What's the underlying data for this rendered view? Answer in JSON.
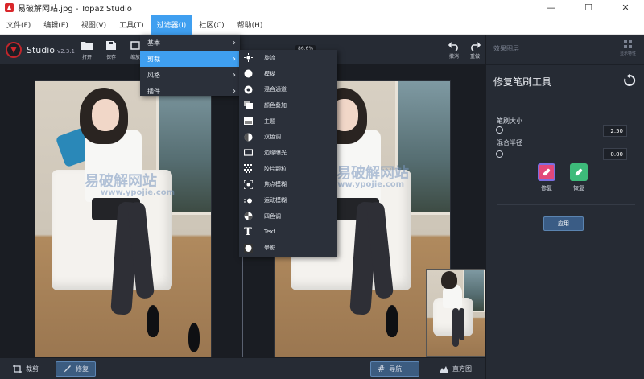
{
  "window": {
    "title": "易破解网站.jpg - Topaz Studio",
    "minimize": "—",
    "maximize": "☐",
    "close": "✕"
  },
  "menubar": [
    {
      "label": "文件(F)"
    },
    {
      "label": "编辑(E)"
    },
    {
      "label": "视图(V)"
    },
    {
      "label": "工具(T)"
    },
    {
      "label": "过滤器(I)",
      "active": true
    },
    {
      "label": "社区(C)"
    },
    {
      "label": "帮助(H)"
    }
  ],
  "toolbar": {
    "brand": "Studio",
    "version": "v2.3.1",
    "tools": [
      {
        "label": "打开"
      },
      {
        "label": "保存"
      },
      {
        "label": "缩放"
      }
    ],
    "zoom": "86.6%",
    "undo": "撤消",
    "redo": "重做"
  },
  "filter_menu": {
    "items": [
      {
        "label": "基本"
      },
      {
        "label": "剪裁",
        "highlighted": true
      },
      {
        "label": "风格"
      },
      {
        "label": "插件"
      }
    ]
  },
  "submenu": {
    "items": [
      {
        "label": "旋流",
        "icon": "sun-icon"
      },
      {
        "label": "模糊",
        "icon": "circle-icon"
      },
      {
        "label": "混合通道",
        "icon": "channels-icon"
      },
      {
        "label": "颜色叠加",
        "icon": "overlay-icon"
      },
      {
        "label": "主题",
        "icon": "theme-icon"
      },
      {
        "label": "双色调",
        "icon": "duotone-icon"
      },
      {
        "label": "边缘曝光",
        "icon": "edge-icon"
      },
      {
        "label": "胶片颗粒",
        "icon": "grain-icon"
      },
      {
        "label": "焦点模糊",
        "icon": "focus-icon"
      },
      {
        "label": "运动模糊",
        "icon": "motion-icon"
      },
      {
        "label": "四色调",
        "icon": "quad-icon"
      },
      {
        "label": "Text",
        "icon": "text-icon"
      },
      {
        "label": "晕影",
        "icon": "vignette-icon"
      }
    ]
  },
  "watermark": {
    "site": "易破解网站",
    "url": "www.ypojie.com"
  },
  "bottombar": {
    "crop": "裁剪",
    "repair": "修复",
    "navigate": "导航",
    "histogram": "直方图"
  },
  "side_panel": {
    "top_label": "效果图层",
    "top_icon_label": "显示特性",
    "title": "修复笔刷工具",
    "brush_size": {
      "label": "笔刷大小",
      "value": "2.50",
      "level": 0.0
    },
    "blend_radius": {
      "label": "混合半径",
      "value": "0.00",
      "level": 0.0
    },
    "repair_label": "修复",
    "restore_label": "恢复",
    "apply_label": "应用",
    "colors": {
      "repair": "#e2487a",
      "restore": "#3dbb7a",
      "accent": "#3f9ff0"
    }
  }
}
